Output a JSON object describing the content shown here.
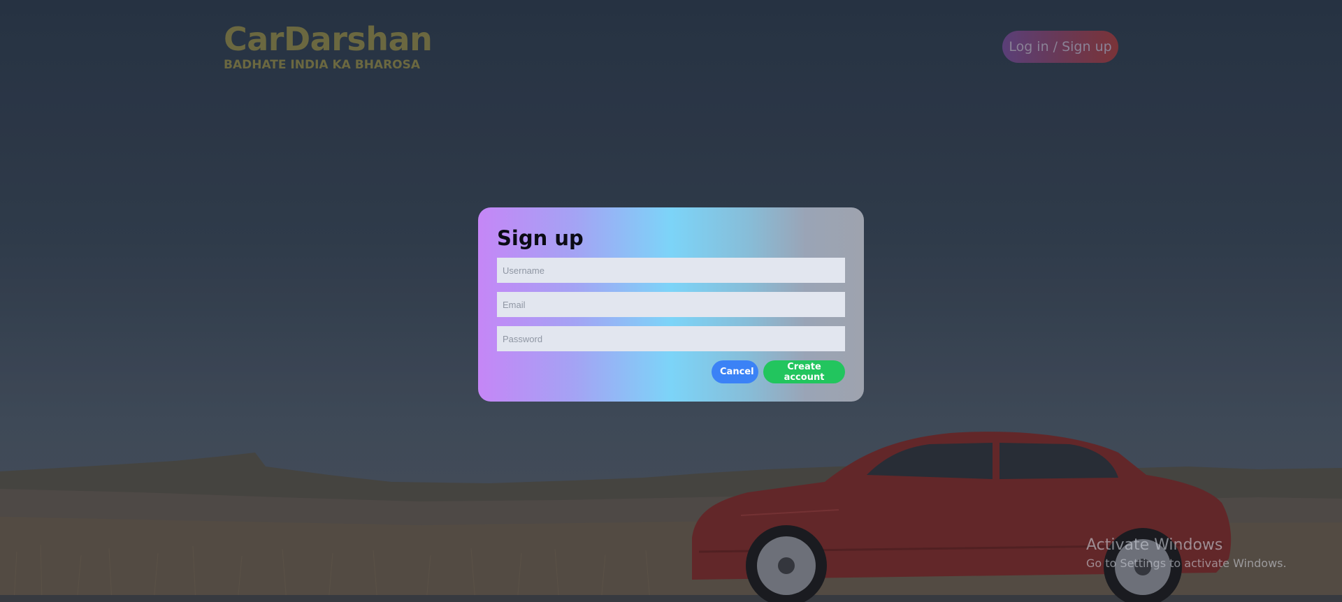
{
  "header": {
    "brand_title": "CarDarshan",
    "brand_tagline": "BADHATE INDIA KA BHAROSA",
    "login_label": "Log in / Sign up"
  },
  "signup_modal": {
    "title": "Sign up",
    "username_placeholder": "Username",
    "email_placeholder": "Email",
    "password_placeholder": "Password",
    "cancel_label": "Cancel",
    "create_label": "Create account"
  },
  "watermark": {
    "title": "Activate Windows",
    "subtitle": "Go to Settings to activate Windows."
  },
  "colors": {
    "brand_text": "#6b6840",
    "cancel_button": "#3b82f6",
    "create_button": "#22c55e",
    "modal_gradient_start": "#c586f6",
    "modal_gradient_mid": "#7cd4f8",
    "modal_gradient_end": "#9ea3ae"
  }
}
